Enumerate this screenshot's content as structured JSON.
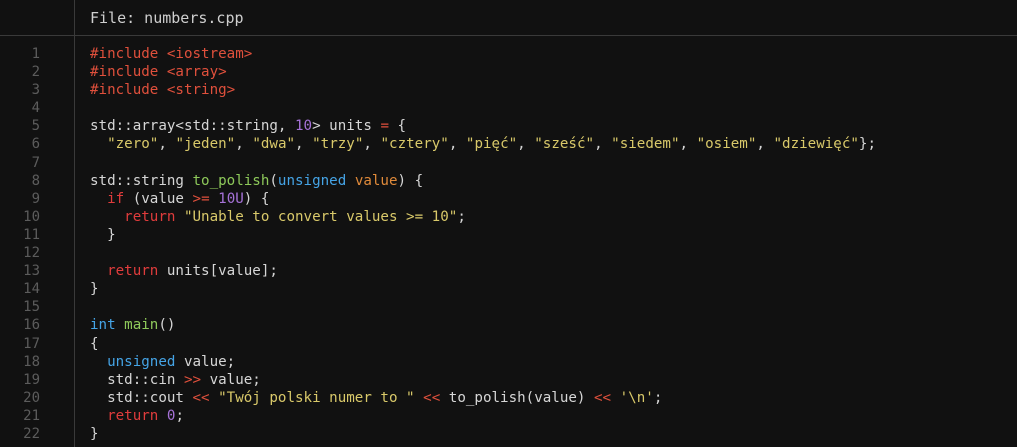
{
  "header": {
    "title": "File: numbers.cpp"
  },
  "colors": {
    "background": "#111111",
    "line_number": "#5c5c5c",
    "default": "#d6d6d6",
    "preprocessor": "#e0503c",
    "number": "#a672d8",
    "operator": "#e0503c",
    "string": "#d9c96a",
    "keyword": "#e03c3c",
    "type": "#45a4e6",
    "function": "#8ec95a",
    "parameter": "#e08a3a"
  },
  "lines": [
    {
      "num": "1",
      "tokens": [
        {
          "t": "#include ",
          "c": "preproc"
        },
        {
          "t": "<iostream>",
          "c": "include"
        }
      ]
    },
    {
      "num": "2",
      "tokens": [
        {
          "t": "#include ",
          "c": "preproc"
        },
        {
          "t": "<array>",
          "c": "include"
        }
      ]
    },
    {
      "num": "3",
      "tokens": [
        {
          "t": "#include ",
          "c": "preproc"
        },
        {
          "t": "<string>",
          "c": "include"
        }
      ]
    },
    {
      "num": "4",
      "tokens": []
    },
    {
      "num": "5",
      "tokens": [
        {
          "t": "std::array<std::string, ",
          "c": "default"
        },
        {
          "t": "10",
          "c": "number"
        },
        {
          "t": "> units ",
          "c": "default"
        },
        {
          "t": "=",
          "c": "op"
        },
        {
          "t": " {",
          "c": "default"
        }
      ]
    },
    {
      "num": "6",
      "tokens": [
        {
          "t": "  ",
          "c": "default"
        },
        {
          "t": "\"zero\"",
          "c": "string"
        },
        {
          "t": ", ",
          "c": "default"
        },
        {
          "t": "\"jeden\"",
          "c": "string"
        },
        {
          "t": ", ",
          "c": "default"
        },
        {
          "t": "\"dwa\"",
          "c": "string"
        },
        {
          "t": ", ",
          "c": "default"
        },
        {
          "t": "\"trzy\"",
          "c": "string"
        },
        {
          "t": ", ",
          "c": "default"
        },
        {
          "t": "\"cztery\"",
          "c": "string"
        },
        {
          "t": ", ",
          "c": "default"
        },
        {
          "t": "\"pięć\"",
          "c": "string"
        },
        {
          "t": ", ",
          "c": "default"
        },
        {
          "t": "\"sześć\"",
          "c": "string"
        },
        {
          "t": ", ",
          "c": "default"
        },
        {
          "t": "\"siedem\"",
          "c": "string"
        },
        {
          "t": ", ",
          "c": "default"
        },
        {
          "t": "\"osiem\"",
          "c": "string"
        },
        {
          "t": ", ",
          "c": "default"
        },
        {
          "t": "\"dziewięć\"",
          "c": "string"
        },
        {
          "t": "};",
          "c": "default"
        }
      ]
    },
    {
      "num": "7",
      "tokens": []
    },
    {
      "num": "8",
      "tokens": [
        {
          "t": "std::string ",
          "c": "default"
        },
        {
          "t": "to_polish",
          "c": "func"
        },
        {
          "t": "(",
          "c": "default"
        },
        {
          "t": "unsigned",
          "c": "type"
        },
        {
          "t": " ",
          "c": "default"
        },
        {
          "t": "value",
          "c": "param"
        },
        {
          "t": ") {",
          "c": "default"
        }
      ]
    },
    {
      "num": "9",
      "tokens": [
        {
          "t": "  ",
          "c": "default"
        },
        {
          "t": "if",
          "c": "keyword"
        },
        {
          "t": " (value ",
          "c": "default"
        },
        {
          "t": ">=",
          "c": "op"
        },
        {
          "t": " ",
          "c": "default"
        },
        {
          "t": "10U",
          "c": "number"
        },
        {
          "t": ") {",
          "c": "default"
        }
      ]
    },
    {
      "num": "10",
      "tokens": [
        {
          "t": "    ",
          "c": "default"
        },
        {
          "t": "return",
          "c": "keyword"
        },
        {
          "t": " ",
          "c": "default"
        },
        {
          "t": "\"Unable to convert values >= 10\"",
          "c": "string"
        },
        {
          "t": ";",
          "c": "default"
        }
      ]
    },
    {
      "num": "11",
      "tokens": [
        {
          "t": "  }",
          "c": "default"
        }
      ]
    },
    {
      "num": "12",
      "tokens": []
    },
    {
      "num": "13",
      "tokens": [
        {
          "t": "  ",
          "c": "default"
        },
        {
          "t": "return",
          "c": "keyword"
        },
        {
          "t": " units[value];",
          "c": "default"
        }
      ]
    },
    {
      "num": "14",
      "tokens": [
        {
          "t": "}",
          "c": "default"
        }
      ]
    },
    {
      "num": "15",
      "tokens": []
    },
    {
      "num": "16",
      "tokens": [
        {
          "t": "int",
          "c": "type"
        },
        {
          "t": " ",
          "c": "default"
        },
        {
          "t": "main",
          "c": "func"
        },
        {
          "t": "()",
          "c": "default"
        }
      ]
    },
    {
      "num": "17",
      "tokens": [
        {
          "t": "{",
          "c": "default"
        }
      ]
    },
    {
      "num": "18",
      "tokens": [
        {
          "t": "  ",
          "c": "default"
        },
        {
          "t": "unsigned",
          "c": "type"
        },
        {
          "t": " value;",
          "c": "default"
        }
      ]
    },
    {
      "num": "19",
      "tokens": [
        {
          "t": "  std::cin ",
          "c": "default"
        },
        {
          "t": ">>",
          "c": "op"
        },
        {
          "t": " value;",
          "c": "default"
        }
      ]
    },
    {
      "num": "20",
      "tokens": [
        {
          "t": "  std::cout ",
          "c": "default"
        },
        {
          "t": "<<",
          "c": "op"
        },
        {
          "t": " ",
          "c": "default"
        },
        {
          "t": "\"Twój polski numer to \"",
          "c": "string"
        },
        {
          "t": " ",
          "c": "default"
        },
        {
          "t": "<<",
          "c": "op"
        },
        {
          "t": " to_polish(value) ",
          "c": "default"
        },
        {
          "t": "<<",
          "c": "op"
        },
        {
          "t": " ",
          "c": "default"
        },
        {
          "t": "'\\n'",
          "c": "string"
        },
        {
          "t": ";",
          "c": "default"
        }
      ]
    },
    {
      "num": "21",
      "tokens": [
        {
          "t": "  ",
          "c": "default"
        },
        {
          "t": "return",
          "c": "keyword"
        },
        {
          "t": " ",
          "c": "default"
        },
        {
          "t": "0",
          "c": "number"
        },
        {
          "t": ";",
          "c": "default"
        }
      ]
    },
    {
      "num": "22",
      "tokens": [
        {
          "t": "}",
          "c": "default"
        }
      ]
    }
  ]
}
